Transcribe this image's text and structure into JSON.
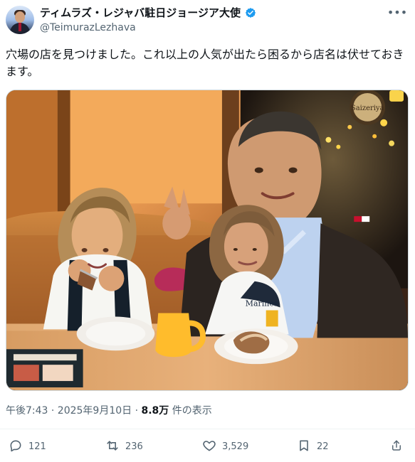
{
  "post": {
    "display_name": "ティムラズ・レジャバ駐日ジョージア大使",
    "handle": "@TeimurazLezhava",
    "text": "穴場の店を見つけました。これ以上の人気が出たら困るから店名は伏せておきます。",
    "timestamp": "午後7:43 · 2025年9月10日 · ",
    "views_count": "8.8万",
    "views_suffix": " 件の表示",
    "more_label": "•••",
    "photo_sign_text": "Saizeriya"
  },
  "stats": {
    "reply": "121",
    "retweet": "236",
    "like": "3,529",
    "bookmark": "22"
  },
  "colors": {
    "text_primary": "#0f1419",
    "text_secondary": "#536471",
    "verified": "#1d9bf0",
    "divider": "#eff3f4"
  },
  "icons": {
    "avatar": "avatar-icon",
    "verified": "verified-badge-icon",
    "more": "more-icon",
    "reply": "reply-icon",
    "retweet": "retweet-icon",
    "like": "heart-icon",
    "bookmark": "bookmark-icon",
    "share": "share-icon"
  }
}
